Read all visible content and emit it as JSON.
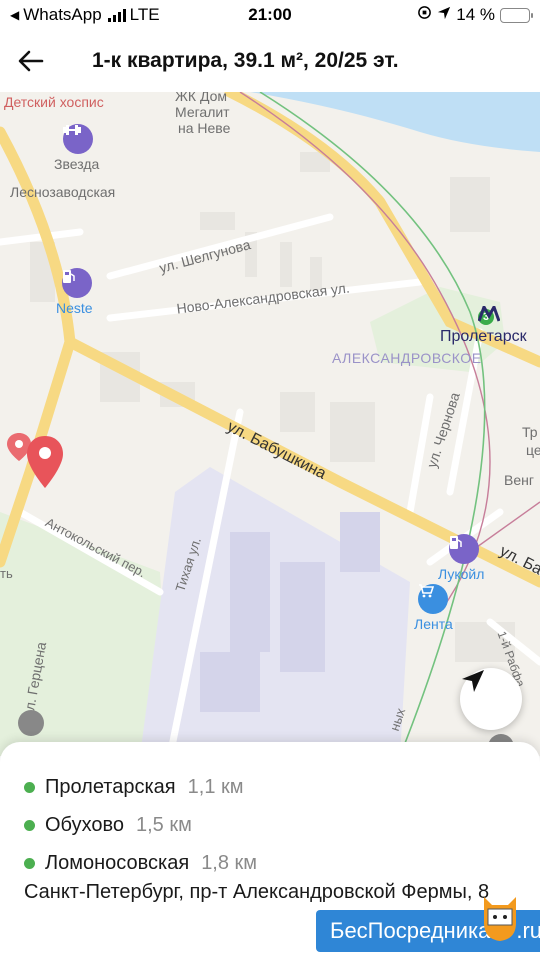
{
  "status_bar": {
    "carrier": "WhatsApp",
    "network": "LTE",
    "time": "21:00",
    "battery_percent": "14 %",
    "battery_level": 0.14
  },
  "header": {
    "title": "1-к квартира, 39.1 м², 20/25 эт."
  },
  "map": {
    "labels": {
      "hospice": "Детский хоспис",
      "zhk_dom": "ЖК Дом",
      "megalit": "Мегалит",
      "na_neve": "на Неве",
      "zvezda": "Звезда",
      "lesnozavodskaya": "Леснозаводская",
      "shelgunova": "ул. Шелгунова",
      "neste": "Neste",
      "novo_alexandrovskaya": "Ново-Александровская ул.",
      "proletarskaya": "Пролетарск",
      "alexandrovskoe": "АЛЕКСАНДРОВСКОЕ",
      "babushkina": "ул. Бабушкина",
      "babushkina_right": "ул. Ба",
      "chernova": "ул. Чернова",
      "antokolsky": "Антокольский пер.",
      "tikhaya": "Тихая ул.",
      "lukoil": "Лукойл",
      "lenta": "Лента",
      "gertsena": "ал. Герцена",
      "right_tr": "Тр",
      "right_ce": "це",
      "right_veng": "Венг",
      "rabfak": "1-й Рабфа",
      "left_edge": "ть",
      "bottom_nykh": "ных"
    },
    "metro_line_number": "3",
    "icons": [
      "gym-icon",
      "fuel-icon",
      "metro-icon",
      "shopping-cart-icon",
      "location-pin-icon",
      "navigation-arrow-icon"
    ],
    "colors": {
      "map_bg": "#f3f1ec",
      "water": "#bfdff5",
      "park": "#e4f0dc",
      "industrial": "#e4e4f2",
      "main_road": "#f7d983",
      "pin_red": "#e8545a",
      "poi_purple": "#7a64c8",
      "poi_blue": "#3a8fe0",
      "metro_green": "#3aab4a"
    }
  },
  "info": {
    "metro": [
      {
        "name": "Пролетарская",
        "distance": "1,1 км"
      },
      {
        "name": "Обухово",
        "distance": "1,5 км"
      },
      {
        "name": "Ломоносовская",
        "distance": "1,8 км"
      }
    ],
    "address": "Санкт-Петербург, пр-т Александровской Фермы, 8"
  },
  "brand": {
    "name": "БесПосредника",
    "suffix": ".ru"
  }
}
